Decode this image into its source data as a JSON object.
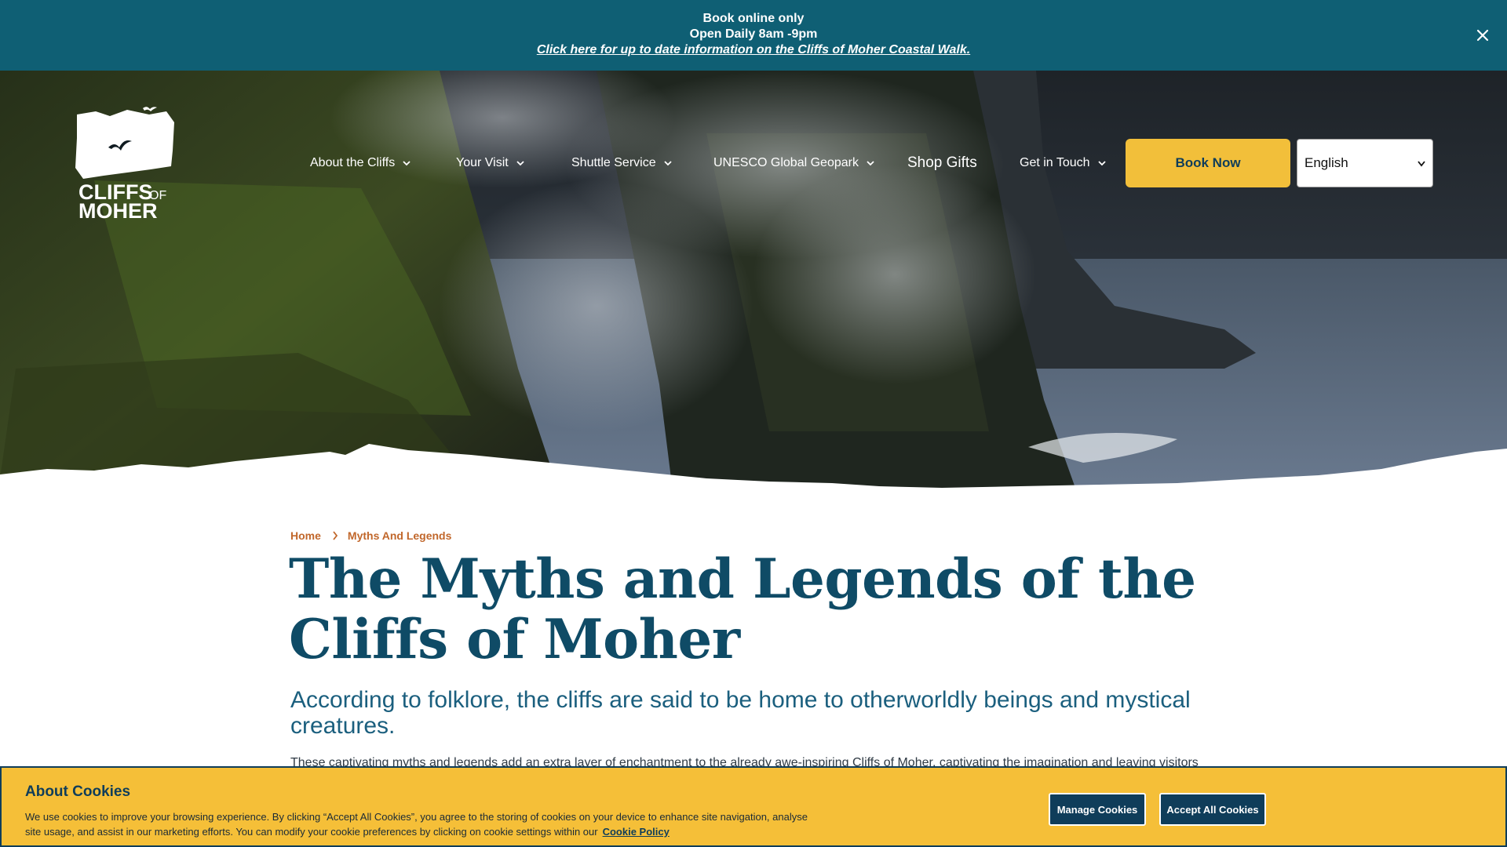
{
  "announcement": {
    "line1": "Book online only",
    "line2": "Open Daily 8am -9pm",
    "link": "Click here for up to date information on the Cliffs of Moher Coastal Walk."
  },
  "brand": {
    "logo_line1": "CLIFFS",
    "logo_of": "OF",
    "logo_line2": "MOHER"
  },
  "nav": {
    "items": [
      {
        "label": "About the Cliffs"
      },
      {
        "label": "Your Visit"
      },
      {
        "label": "Shuttle Service"
      },
      {
        "label": "UNESCO Global Geopark"
      },
      {
        "label": "Shop Gifts"
      },
      {
        "label": "Get in Touch"
      }
    ],
    "book_label": "Book Now",
    "language_selected": "English"
  },
  "breadcrumb": {
    "home": "Home",
    "current": "Myths And Legends"
  },
  "page": {
    "title": "The Myths and Legends of the Cliffs of Moher",
    "lede": "According to folklore, the cliffs are said to be home to otherworldly beings and mystical creatures.",
    "body": "These captivating myths and legends add an extra layer of enchantment to the already awe-inspiring Cliffs of Moher, captivating the imagination and leaving visitors"
  },
  "cookie": {
    "title": "About Cookies",
    "text": "We use cookies to improve your browsing experience. By clicking “Accept All Cookies”, you agree to the storing of cookies on your device to enhance site navigation, analyse site usage, and assist in our marketing efforts. You can modify your cookie preferences by clicking on cookie settings within our",
    "policy_link": "Cookie Policy",
    "manage_label": "Manage Cookies",
    "accept_label": "Accept All Cookies"
  },
  "colors": {
    "banner": "#0f5f74",
    "accent": "#f2bf3a",
    "title": "#0f4b66",
    "breadcrumb": "#c1672b",
    "cookie_bg": "#f5bf38"
  },
  "icons": {
    "close": "close-icon",
    "chevron": "chevron-down-icon",
    "breadcrumb_sep": "chevron-right-icon",
    "birds": "birds-icon"
  }
}
